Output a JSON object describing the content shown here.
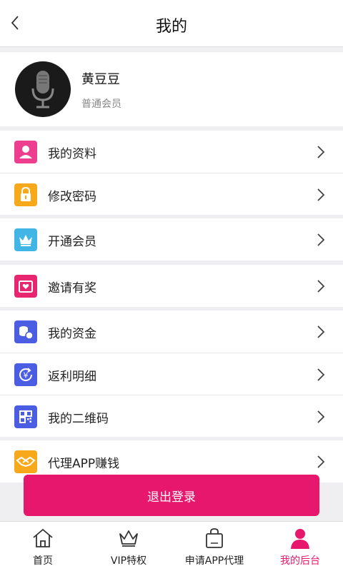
{
  "header": {
    "title": "我的"
  },
  "profile": {
    "name": "黄豆豆",
    "level": "普通会员"
  },
  "menu_groups": [
    {
      "items": [
        {
          "label": "我的资料",
          "icon": "user-profile-icon",
          "color": "#ee3e8f"
        },
        {
          "label": "修改密码",
          "icon": "lock-icon",
          "color": "#f7a81b"
        }
      ]
    },
    {
      "items": [
        {
          "label": "开通会员",
          "icon": "crown-icon",
          "color": "#41b6e6"
        }
      ]
    },
    {
      "items": [
        {
          "label": "邀请有奖",
          "icon": "gift-envelope-icon",
          "color": "#e8256f"
        }
      ]
    },
    {
      "items": [
        {
          "label": "我的资金",
          "icon": "coins-icon",
          "color": "#4a5de3"
        },
        {
          "label": "返利明细",
          "icon": "yen-refund-icon",
          "color": "#4a5de3"
        },
        {
          "label": "我的二维码",
          "icon": "qrcode-icon",
          "color": "#4a5de3"
        }
      ]
    },
    {
      "items": [
        {
          "label": "代理APP赚钱",
          "icon": "handshake-icon",
          "color": "#f7a81b"
        }
      ]
    }
  ],
  "logout_label": "退出登录",
  "tabs": [
    {
      "label": "首页",
      "icon": "home-icon"
    },
    {
      "label": "VIP特权",
      "icon": "crown-outline-icon"
    },
    {
      "label": "申请APP代理",
      "icon": "shopping-bag-icon"
    },
    {
      "label": "我的后台",
      "icon": "person-icon",
      "active": true
    }
  ],
  "colors": {
    "accent": "#e8176e",
    "text": "#222222",
    "muted": "#888888",
    "background": "#efeff2"
  }
}
